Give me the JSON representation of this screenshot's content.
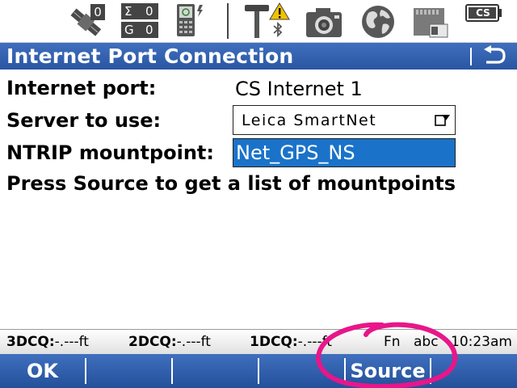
{
  "status_bar": {
    "satellites_count": "0",
    "sigma_count": "0",
    "g_count": "0",
    "sigma_letter": "Σ",
    "g_letter": "G",
    "cs_badge": "CS",
    "icons": [
      "satellite-icon",
      "sigma-g-counter-icon",
      "handheld-device-icon",
      "antenna-warning-icon",
      "bluetooth-icon",
      "camera-icon",
      "globe-icon",
      "memory-card-icon",
      "battery-icon"
    ]
  },
  "title": "Internet Port Connection",
  "form": {
    "internet_port_label": "Internet port:",
    "internet_port_value": "CS Internet 1",
    "server_label": "Server to use:",
    "server_value": "Leica SmartNet",
    "mountpoint_label": "NTRIP mountpoint:",
    "mountpoint_value": "Net_GPS_NS",
    "hint": "Press Source to get a list of mountpoints"
  },
  "info_strip": {
    "cq3d_label": "3DCQ:",
    "cq3d_value": "-.---ft",
    "cq2d_label": "2DCQ:",
    "cq2d_value": "-.---ft",
    "cq1d_label": "1DCQ:",
    "cq1d_value": "-.---ft",
    "fn": "Fn",
    "input_mode": "abc",
    "time": "10:23am"
  },
  "softkeys": {
    "f1": "OK",
    "f2": "",
    "f3": "",
    "f4": "",
    "f5": "Source",
    "f6": ""
  },
  "colors": {
    "title_bar": "#2f5fae",
    "selection": "#1a73c9",
    "annotation": "#e8168a"
  }
}
